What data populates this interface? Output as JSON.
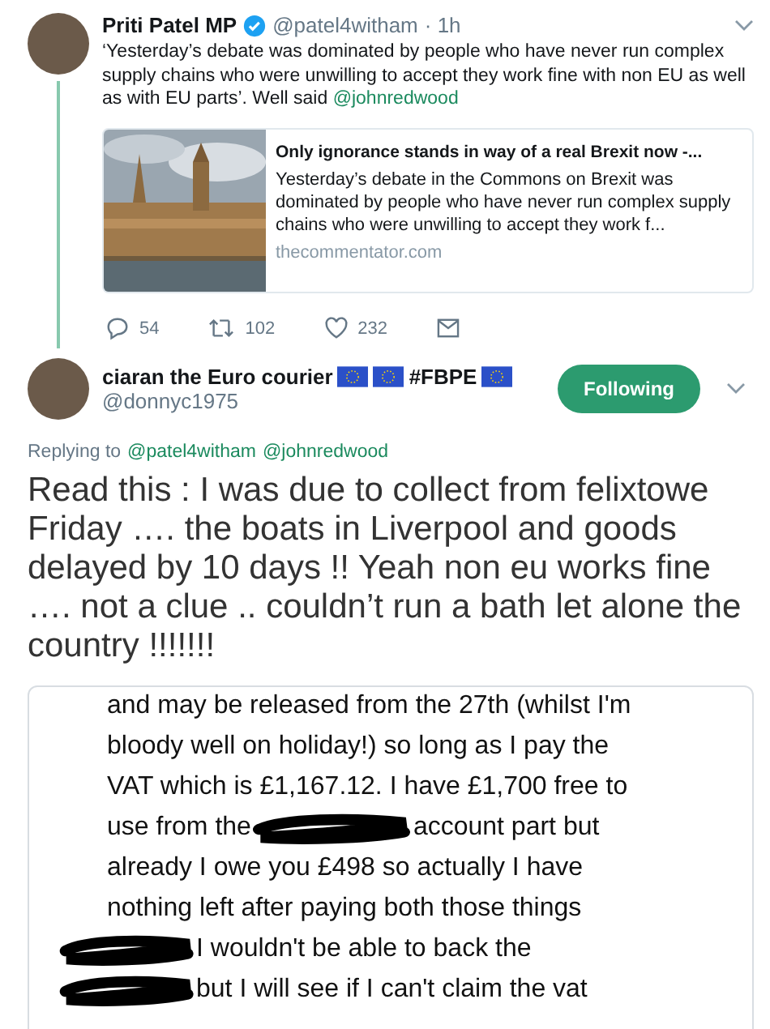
{
  "quoted_tweet": {
    "name": "Priti Patel MP",
    "verified": true,
    "handle": "@patel4witham",
    "time": "· 1h",
    "text": "‘Yesterday’s debate was dominated by people who have never run complex supply chains who were unwilling to accept they work fine with non EU as well as with EU parts’.  Well said",
    "mention": "@johnredwood",
    "card": {
      "kind": "picture",
      "title": "Only ignorance stands in way of a real Brexit now -...",
      "description": "Yesterday’s debate in the Commons on Brexit was dominated by people who have never run complex supply chains who were unwilling to accept they work f...",
      "domain": "thecommentator.com"
    },
    "actions": [
      {
        "kind": "reply",
        "count": "54"
      },
      {
        "kind": "retweet",
        "count": "102"
      },
      {
        "kind": "like",
        "count": "232"
      },
      {
        "kind": "message"
      }
    ]
  },
  "tweet": {
    "name": "ciaran the Euro courier",
    "name_extras": [
      {
        "kind": "flag"
      },
      {
        "kind": "flag"
      },
      {
        "kind": "text",
        "text": "#FBPE"
      },
      {
        "kind": "flag"
      }
    ],
    "handle": "@donnyc1975",
    "follow_button": {
      "label": "Following",
      "on": true
    },
    "replying_label": "Replying to",
    "replying_to": [
      "@patel4witham",
      "@johnredwood"
    ],
    "text": "Read this : I was due to collect from felixtowe Friday …. the boats in Liverpool and goods delayed by 10 days !! Yeah non eu works fine …. not a clue .. couldn’t run a bath let alone the country !!!!!!!",
    "image_lines": [
      {
        "segments": [
          {
            "kind": "text",
            "text": "and may be released from the 27th (whilst I'm"
          }
        ]
      },
      {
        "segments": [
          {
            "kind": "text",
            "text": "bloody well on holiday!) so long as I pay the"
          }
        ]
      },
      {
        "segments": [
          {
            "kind": "text",
            "text": "VAT which is £1,167.12. I have £1,700 free to"
          }
        ]
      },
      {
        "segments": [
          {
            "kind": "text",
            "text": "use from the"
          },
          {
            "kind": "redaction"
          },
          {
            "kind": "text",
            "text": "account part but"
          }
        ]
      },
      {
        "segments": [
          {
            "kind": "text",
            "text": "already I owe you £498 so actually I have"
          }
        ]
      },
      {
        "segments": [
          {
            "kind": "text",
            "text": "nothing left after paying both those things"
          }
        ]
      },
      {
        "segments": [
          {
            "kind": "redaction"
          },
          {
            "kind": "text",
            "text": "I wouldn't be able to back the"
          }
        ]
      },
      {
        "segments": [
          {
            "kind": "redaction"
          },
          {
            "kind": "text",
            "text": "but I will see if I can't claim the vat"
          }
        ]
      }
    ]
  }
}
